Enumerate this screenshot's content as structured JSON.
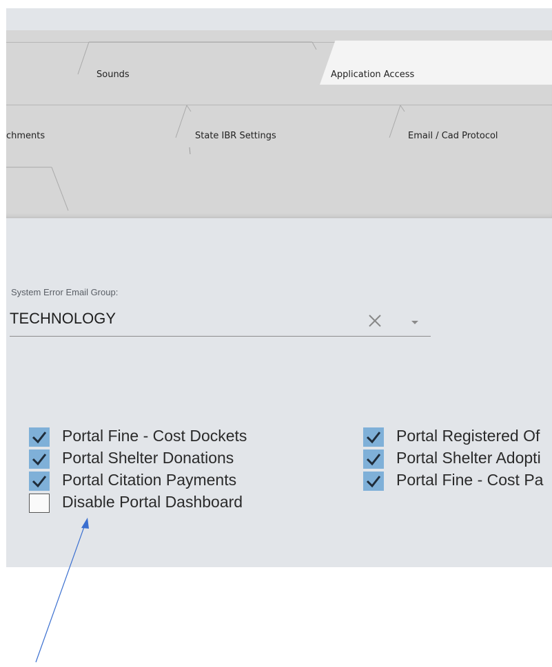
{
  "tabs": {
    "row1": [
      {
        "label": "Sounds",
        "active": false
      },
      {
        "label": "Application Access",
        "active": true
      }
    ],
    "row2": [
      {
        "label": "chments",
        "active": false
      },
      {
        "label": "State IBR Settings",
        "active": false
      },
      {
        "label": "Email / Cad Protocol",
        "active": false
      }
    ]
  },
  "email_group": {
    "label": "System Error Email Group:",
    "value": "TECHNOLOGY",
    "clear_icon": "close-icon",
    "dropdown_icon": "caret-down-icon"
  },
  "checkboxes": {
    "left": [
      {
        "label": "Portal Fine - Cost Dockets",
        "checked": true
      },
      {
        "label": "Portal Shelter Donations",
        "checked": true
      },
      {
        "label": "Portal Citation Payments",
        "checked": true
      },
      {
        "label": "Disable Portal Dashboard",
        "checked": false
      }
    ],
    "right": [
      {
        "label": "Portal Registered Of",
        "checked": true
      },
      {
        "label": "Portal Shelter Adopti",
        "checked": true
      },
      {
        "label": "Portal Fine - Cost Pa",
        "checked": true
      }
    ]
  },
  "colors": {
    "checkbox_checked": "#7fb0d8",
    "annotation_arrow": "#3a6fd0"
  }
}
